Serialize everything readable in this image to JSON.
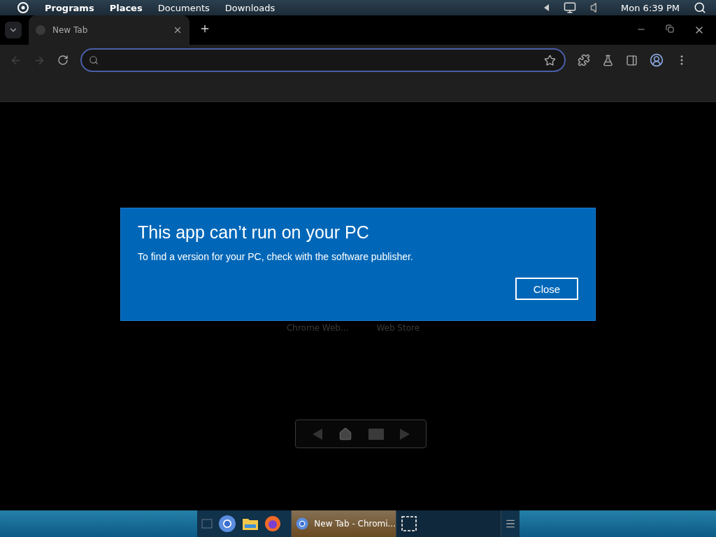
{
  "top_panel": {
    "menus": [
      "Programs",
      "Places",
      "Documents",
      "Downloads"
    ],
    "clock": "Mon 6:39 PM"
  },
  "browser": {
    "tabs": [
      {
        "label": "New Tab",
        "selected": true
      }
    ]
  },
  "page": {
    "shortcuts": [
      "Chrome Web...",
      "Web Store"
    ]
  },
  "dialog": {
    "title": "This app can’t run on your PC",
    "message": "To find a version for your PC, check with the software publisher.",
    "button": "Close"
  },
  "taskbar": {
    "tasks": [
      {
        "label": "New Tab - Chromi...",
        "selected": true,
        "kind": "browser"
      },
      {
        "selected": false,
        "kind": "screenshot"
      }
    ]
  }
}
